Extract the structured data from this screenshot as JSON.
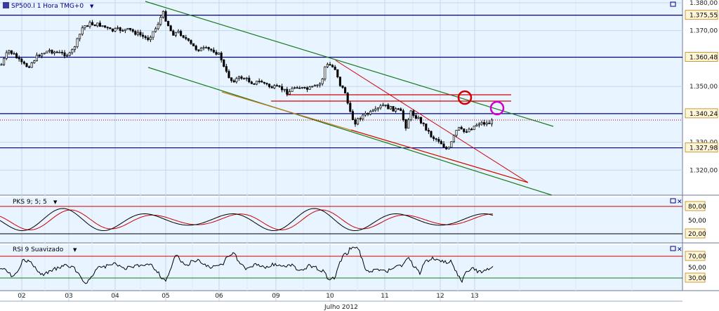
{
  "colors": {
    "background": "#ffffff",
    "plot_bg": "#e8f4ff",
    "grid": "#c5d6e6",
    "blue_level": "#00008b",
    "red": "#d00000",
    "green": "#1a7a1a",
    "magenta": "#d000d0",
    "candle": "#000000",
    "axis_text": "#222222"
  },
  "chart_data": [
    {
      "id": "price",
      "type": "candlestick",
      "title": "SP500.I 1 Hora TMG+0",
      "y_ticks": [
        "1.380,00",
        "1.370,00",
        "1.350,00",
        "1.330,00",
        "1.320,00"
      ],
      "levels": [
        {
          "value": 1375.55,
          "label": "1.375,55"
        },
        {
          "value": 1360.48,
          "label": "1.360,48"
        },
        {
          "value": 1340.24,
          "label": "1.340,24"
        },
        {
          "value": 1327.98,
          "label": "1.327,98"
        }
      ],
      "ylim": [
        1311,
        1381
      ]
    },
    {
      "id": "pks",
      "type": "line",
      "title": "PKS 9; 5; 5",
      "y_ticks": [
        "80,00",
        "50,00",
        "20,00"
      ],
      "ylim": [
        0,
        100
      ]
    },
    {
      "id": "rsi",
      "type": "line",
      "title": "RSI 9 Suavizado",
      "y_ticks": [
        "70,00",
        "50,00",
        "30,00"
      ],
      "ylim": [
        20,
        80
      ]
    }
  ],
  "x_axis": {
    "days": [
      "02",
      "03",
      "04",
      "05",
      "06",
      "09",
      "10",
      "11",
      "12",
      "13"
    ],
    "month_label": "Julho 2012"
  }
}
